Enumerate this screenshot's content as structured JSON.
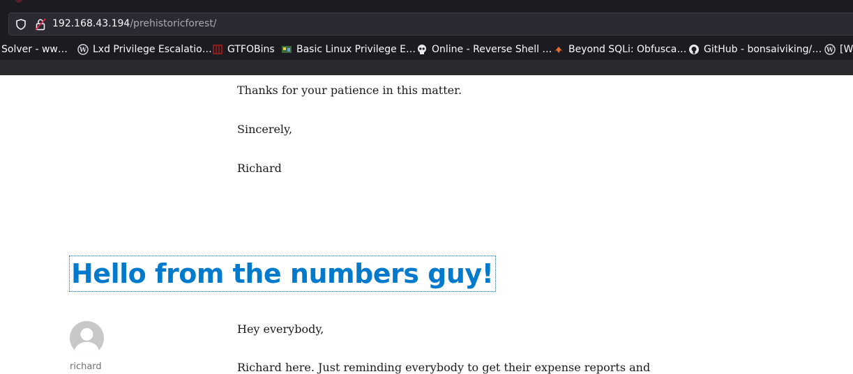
{
  "browser": {
    "url_host": "192.168.43.194",
    "url_path": "/prehistoricforest/"
  },
  "bookmarks": [
    {
      "label": "Solver - ww…",
      "icon": "none"
    },
    {
      "label": "Lxd Privilege Escalatio…",
      "icon": "wordpress-icon"
    },
    {
      "label": "GTFOBins",
      "icon": "gtfobins-icon"
    },
    {
      "label": "Basic Linux Privilege E…",
      "icon": "game-icon"
    },
    {
      "label": "Online - Reverse Shell …",
      "icon": "skull-icon"
    },
    {
      "label": "Beyond SQLi: Obfusca…",
      "icon": "flame-icon"
    },
    {
      "label": "GitHub - bonsaiviking/…",
      "icon": "github-icon"
    },
    {
      "label": "[W",
      "icon": "wordpress-icon"
    }
  ],
  "post_previous": {
    "closing_line": "Thanks for your patience in this matter.",
    "signoff": "Sincerely,",
    "signature": "Richard"
  },
  "post": {
    "title": "Hello from the numbers guy!",
    "author": "richard",
    "greeting": "Hey everybody,",
    "first_line": "Richard here.  Just reminding everybody to get their expense reports and"
  }
}
